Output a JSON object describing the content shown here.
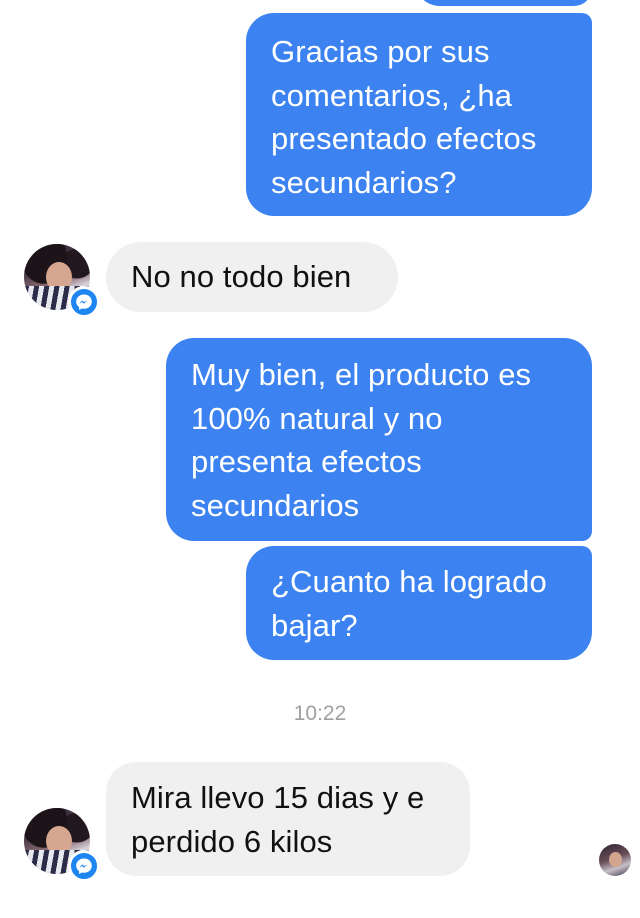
{
  "conversation": {
    "messages": [
      {
        "direction": "outgoing",
        "lines": [
          "Gracias por sus",
          "comentarios, ¿ha",
          "presentado efectos",
          "secundarios?"
        ]
      },
      {
        "direction": "incoming",
        "lines": [
          "No no todo bien"
        ]
      },
      {
        "direction": "outgoing",
        "lines": [
          "Muy bien, el producto es",
          "100% natural y no",
          "presenta efectos",
          "secundarios"
        ]
      },
      {
        "direction": "outgoing",
        "lines": [
          "¿Cuanto ha logrado",
          "bajar?"
        ]
      },
      {
        "direction": "incoming",
        "lines": [
          "Mira llevo 15 dias y e",
          "perdido 6 kilos"
        ]
      }
    ],
    "timestamp": "10:22"
  },
  "colors": {
    "outgoing_bubble": "#3c83f1",
    "incoming_bubble": "#f0f0f0",
    "messenger_badge": "#1e86f0",
    "timestamp_text": "#a0a0a0"
  },
  "icons": {
    "sender_avatar": "user-avatar",
    "badge": "messenger-icon",
    "read_receipt": "seen-avatar"
  }
}
